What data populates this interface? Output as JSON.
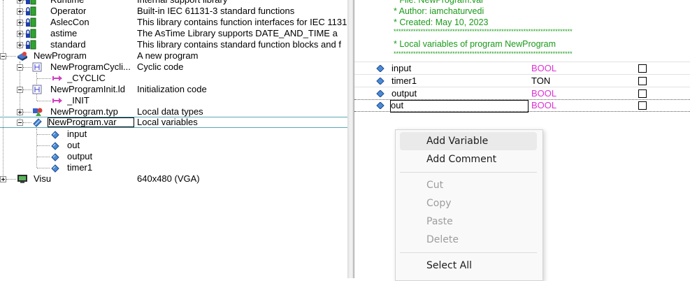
{
  "tree": {
    "rows": [
      {
        "name": "Runtime",
        "desc": "Internal support library"
      },
      {
        "name": "Operator",
        "desc": "Built-in IEC 61131-3 standard functions"
      },
      {
        "name": "AslecCon",
        "desc": "This library contains function interfaces for IEC 1131"
      },
      {
        "name": "astime",
        "desc": "The AsTime Library supports DATE_AND_TIME a"
      },
      {
        "name": "standard",
        "desc": "This library contains standard function blocks and f"
      },
      {
        "name": "NewProgram",
        "desc": "A new program"
      },
      {
        "name": "NewProgramCycli...",
        "desc": "Cyclic code"
      },
      {
        "name": "_CYCLIC",
        "desc": ""
      },
      {
        "name": "NewProgramInit.ld",
        "desc": "Initialization code"
      },
      {
        "name": "_INIT",
        "desc": ""
      },
      {
        "name": "NewProgram.typ",
        "desc": "Local data types"
      },
      {
        "name": "NewProgram.var",
        "desc": "Local variables"
      },
      {
        "name": "input",
        "desc": ""
      },
      {
        "name": "out",
        "desc": ""
      },
      {
        "name": "output",
        "desc": ""
      },
      {
        "name": "timer1",
        "desc": ""
      },
      {
        "name": "Visu",
        "desc": "640x480 (VGA)"
      }
    ]
  },
  "editor": {
    "comments": [
      "* File: NewProgram.var",
      "* Author: iamchaturvedi",
      "* Created: May 10, 2023",
      "*************************************************************************",
      "* Local variables of program NewProgram",
      "*************************************************************************"
    ],
    "variables": [
      {
        "name": "input",
        "type": "BOOL"
      },
      {
        "name": "timer1",
        "type": "TON"
      },
      {
        "name": "output",
        "type": "BOOL"
      },
      {
        "name": "out",
        "type": "BOOL"
      }
    ]
  },
  "menu": {
    "add_variable": "Add Variable",
    "add_comment": "Add Comment",
    "cut": "Cut",
    "copy": "Copy",
    "paste": "Paste",
    "delete": "Delete",
    "select_all": "Select All"
  },
  "colors": {
    "comment": "#1a9b1a",
    "type_keyword": "#e02fd4",
    "selection_border": "#5aa9b3"
  }
}
